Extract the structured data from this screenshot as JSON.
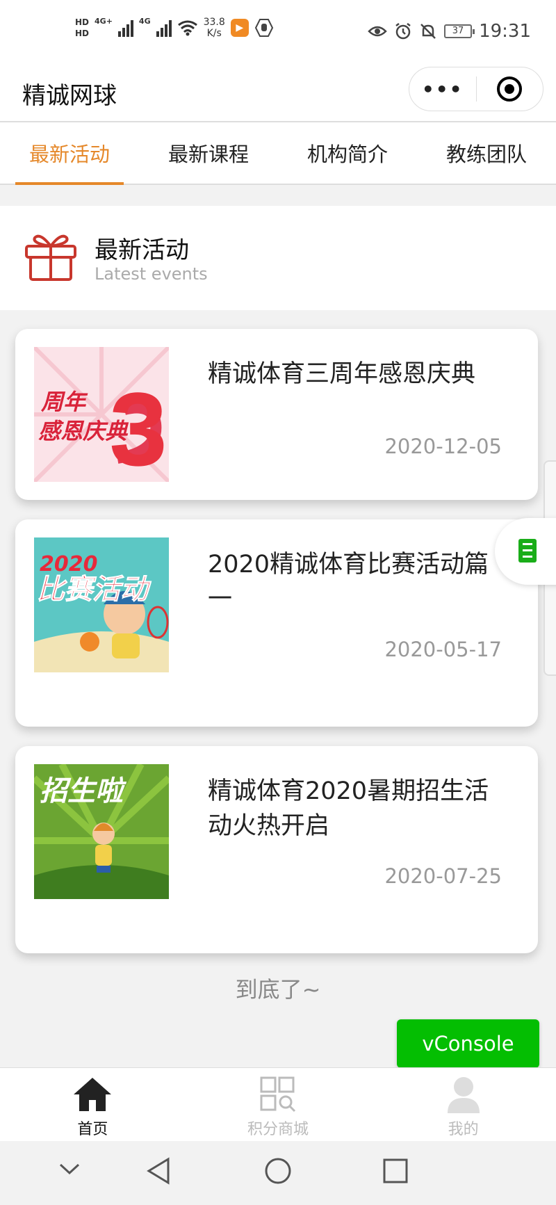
{
  "status_bar": {
    "hd1": "HD",
    "hd2": "HD",
    "net1": "4G+",
    "net2": "4G",
    "speed_value": "33.8",
    "speed_unit": "K/s",
    "battery": "37",
    "time": "19:31"
  },
  "header": {
    "title": "精诚网球",
    "more_icon": "more-dots-icon",
    "close_icon": "target-circle-icon"
  },
  "tabs": [
    {
      "label": "最新活动",
      "active": true
    },
    {
      "label": "最新课程",
      "active": false
    },
    {
      "label": "机构简介",
      "active": false
    },
    {
      "label": "教练团队",
      "active": false
    }
  ],
  "section": {
    "title": "最新活动",
    "subtitle": "Latest events",
    "icon": "gift-icon"
  },
  "events": [
    {
      "title": "精诚体育三周年感恩庆典",
      "date": "2020-12-05",
      "thumb_text_a": "周年",
      "thumb_text_b": "感恩庆典",
      "thumb_num": "3"
    },
    {
      "title": "2020精诚体育比赛活动篇一",
      "date": "2020-05-17",
      "thumb_text_a": "2020",
      "thumb_text_b": "比赛活动"
    },
    {
      "title": "精诚体育2020暑期招生活动火热开启",
      "date": "2020-07-25",
      "thumb_text_a": "招生啦"
    }
  ],
  "end_text": "到底了~",
  "vconsole_label": "vConsole",
  "bottom_tabs": [
    {
      "label": "首页",
      "icon": "home-icon",
      "active": true
    },
    {
      "label": "积分商城",
      "icon": "grid-search-icon",
      "active": false
    },
    {
      "label": "我的",
      "icon": "user-icon",
      "active": false
    }
  ],
  "colors": {
    "accent": "#e5882a",
    "vconsole": "#04be02",
    "gift": "#c8372d"
  }
}
